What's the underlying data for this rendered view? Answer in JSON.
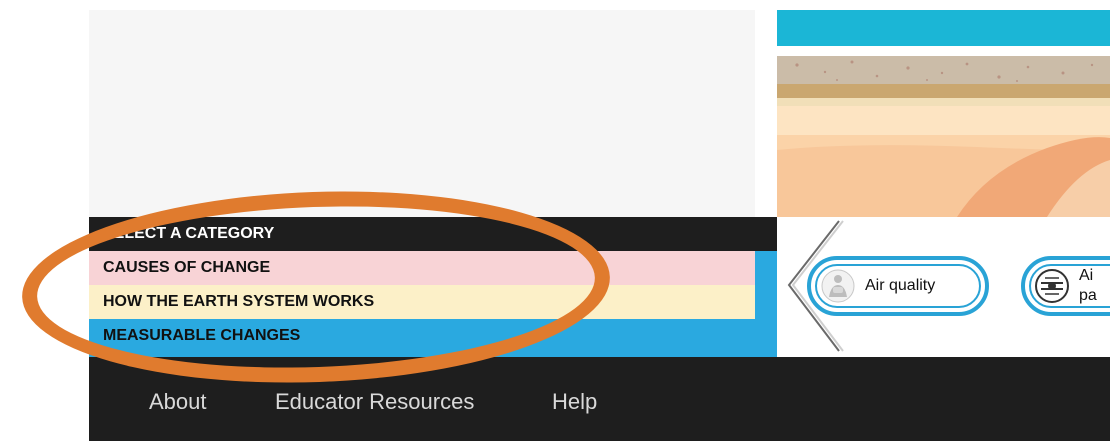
{
  "categories": {
    "header": "SELECT A CATEGORY",
    "items": [
      {
        "label": "CAUSES OF CHANGE",
        "color": "#f8d3d6"
      },
      {
        "label": "HOW THE EARTH SYSTEM WORKS",
        "color": "#fcf0c8"
      },
      {
        "label": "MEASURABLE CHANGES",
        "color": "#2aa9e0"
      }
    ]
  },
  "carousel": {
    "items": [
      {
        "label": "Air quality",
        "icon": "air-quality-icon"
      },
      {
        "label_line1": "Ai",
        "label_line2": "pa",
        "icon": "air-pressure-icon"
      }
    ],
    "prev_icon": "chevron-left-icon"
  },
  "footer": {
    "links": [
      "About",
      "Educator Resources",
      "Help"
    ]
  },
  "colors": {
    "dark": "#1e1e1e",
    "accent_blue": "#2aa9e0",
    "highlight_orange": "#e07b2e",
    "sky": "#1bb6d6"
  }
}
